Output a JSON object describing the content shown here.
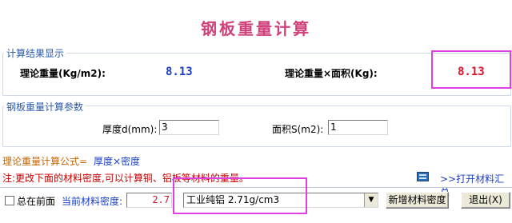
{
  "title": "钢板重量计算",
  "results_group": {
    "legend": "计算结果显示",
    "theoretical_weight_label": "理论重量(Kg/m2):",
    "theoretical_weight_value": "8.13",
    "weight_area_label": "理论重量×面积(Kg):",
    "weight_area_value": "8.13"
  },
  "params_group": {
    "legend": "钢板重量计算参数",
    "thickness_label": "厚度d(mm):",
    "thickness_value": "3",
    "area_label": "面积S(m2):",
    "area_value": "1"
  },
  "formula": {
    "label": "理论重量计算公式=",
    "expression": "厚度×密度"
  },
  "note": "注:更改下面的材料密度,可以计算铜、铝板等材料的重量。",
  "open_materials_link": ">>打开材料汇总",
  "bottom": {
    "always_on_top_label": "总在前面",
    "density_label": "当前材料密度:",
    "density_value": "2.7",
    "material_selected": "工业纯铝 2.71g/cm3",
    "add_density_button": "新增材料密度",
    "exit_button": "退出(X)"
  },
  "colors": {
    "title": "#d0407a",
    "legend": "#2b5aa8",
    "value_blue": "#1a3ec8",
    "value_red": "#e0102a",
    "formula_orange": "#c86400",
    "formula_blue": "#1a3ec8",
    "note_red": "#c80000",
    "link_blue": "#1a3ec8",
    "highlight": "#e040e0"
  }
}
